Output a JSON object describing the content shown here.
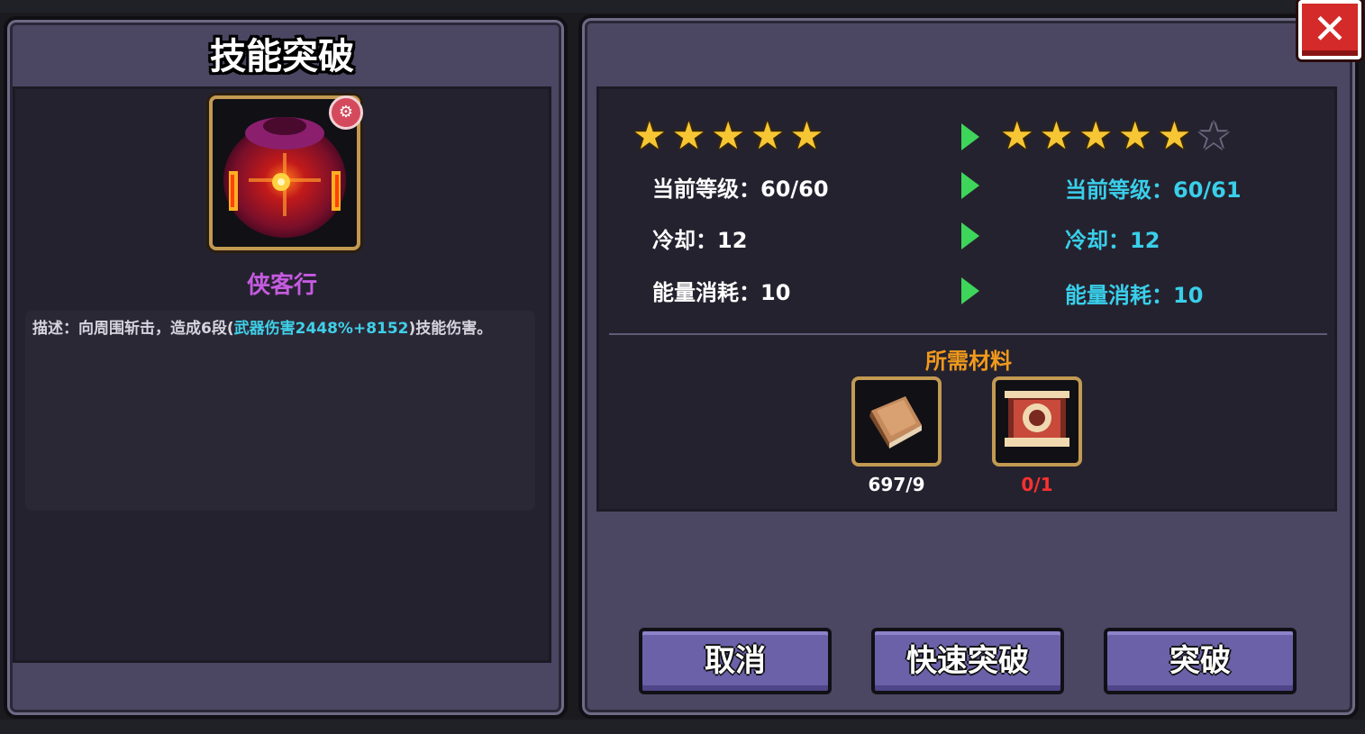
{
  "title": "技能突破",
  "skill": {
    "name": "侠客行",
    "badge_icon": "gear-icon",
    "icon": "red-orb-skill-icon",
    "description_prefix": "描述：向周围斩击，造成6段(",
    "description_highlight": "武器伤害2448%+8152",
    "description_suffix": ")技能伤害。"
  },
  "current": {
    "stars": 5,
    "level": "当前等级：60/60",
    "cooldown": "冷却：12",
    "energy": "能量消耗：10"
  },
  "next": {
    "stars_filled": 5,
    "stars_total": 6,
    "level": "当前等级：60/61",
    "cooldown": "冷却：12",
    "energy": "能量消耗：10"
  },
  "materials": {
    "title": "所需材料",
    "items": [
      {
        "icon": "book-icon",
        "count": "697/9",
        "color": "#ffffff"
      },
      {
        "icon": "scroll-icon",
        "count": "0/1",
        "color": "#ff3030"
      }
    ]
  },
  "buttons": {
    "cancel": "取消",
    "quick_break": "快速突破",
    "break": "突破",
    "close": "✕"
  },
  "colors": {
    "panel": "#4b4762",
    "highlight_cyan": "#39cfea",
    "skill_name": "#c55be0",
    "materials_title": "#f09a1c",
    "arrow_green": "#3ed65a",
    "star_gold": "#f7c634"
  }
}
